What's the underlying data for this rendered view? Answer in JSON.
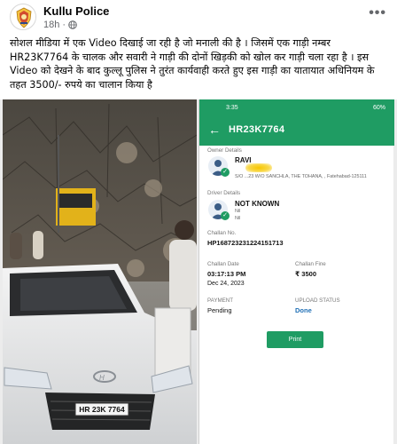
{
  "post": {
    "page_name": "Kullu Police",
    "time": "18h",
    "dot": "·",
    "more_icon": "•••",
    "text": "सोशल मीडिया में एक Video  दिखाई जा रही है जो मनाली की है । जिसमें एक गाड़ी नम्बर HR23K7764 के चालक और सवारी ने गाड़ी की दोनों खिड़की को खोल कर गाड़ी चला रहा है । इस Video को देखने के बाद कुल्लू पुलिस ने तुरंत कार्यवाही करते हुए इस गाड़ी का यातायात अधिनियम के तहत 3500/- रुपये का चालान किया है"
  },
  "video": {
    "plate": "HR 23K 7764"
  },
  "challan_app": {
    "status_time": "3:35",
    "status_battery": "60%",
    "vehicle_number": "HR23K7764",
    "owner_label": "Owner Details",
    "owner_name": "RAVI",
    "owner_address": "S/O  ...23  W/O SANCHLA, THE TOHANA, , Fatehabad-125111",
    "driver_label": "Driver Details",
    "driver_name": "NOT KNOWN",
    "driver_sub": "Nil",
    "driver_sub2": "Nil",
    "challan_no_label": "Challan No.",
    "challan_no": "HP168723231224151713",
    "challan_date_label": "Challan Date",
    "challan_time": "03:17:13 PM",
    "challan_date": "Dec 24, 2023",
    "challan_fine_label": "Challan Fine",
    "challan_fine": "₹ 3500",
    "payment_label": "PAYMENT",
    "payment_value": "Pending",
    "upload_label": "UPLOAD STATUS",
    "upload_value": "Done",
    "print_label": "Print"
  },
  "colors": {
    "app_green": "#1f9c63",
    "meta_gray": "#65676b"
  },
  "icons": [
    "police-emblem-icon",
    "globe-icon",
    "more-options-icon",
    "back-arrow-icon",
    "person-icon",
    "check-icon"
  ]
}
